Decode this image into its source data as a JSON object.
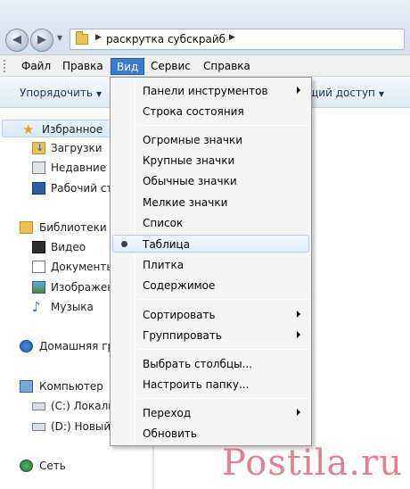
{
  "address": {
    "path": "раскрутка субскрайб"
  },
  "menubar": {
    "items": [
      "Файл",
      "Правка",
      "Вид",
      "Сервис",
      "Справка"
    ],
    "active": "Вид"
  },
  "toolbar": {
    "organize": "Упорядочить",
    "share_partial": "щий доступ"
  },
  "navpane": {
    "favorites": "Избранное",
    "downloads": "Загрузки",
    "recent": "Недавние м",
    "desktop": "Рабочий ст",
    "libraries": "Библиотеки",
    "video": "Видео",
    "documents": "Документы",
    "images": "Изображен",
    "music": "Музыка",
    "homegroup": "Домашняя гр",
    "computer": "Компьютер",
    "drive_c": "(C:) Локаль",
    "drive_d": "(D:) Новый",
    "network": "Сеть"
  },
  "view_menu": {
    "toolbars": "Панели инструментов",
    "status_bar": "Строка состояния",
    "huge_icons": "Огромные значки",
    "large_icons": "Крупные значки",
    "normal_icons": "Обычные значки",
    "small_icons": "Мелкие значки",
    "list": "Список",
    "table": "Таблица",
    "tiles": "Плитка",
    "content": "Содержимое",
    "sort": "Сортировать",
    "group": "Группировать",
    "choose_columns": "Выбрать столбцы...",
    "customize_folder": "Настроить папку...",
    "go": "Переход",
    "refresh": "Обновить"
  },
  "watermark": "Postila.ru"
}
